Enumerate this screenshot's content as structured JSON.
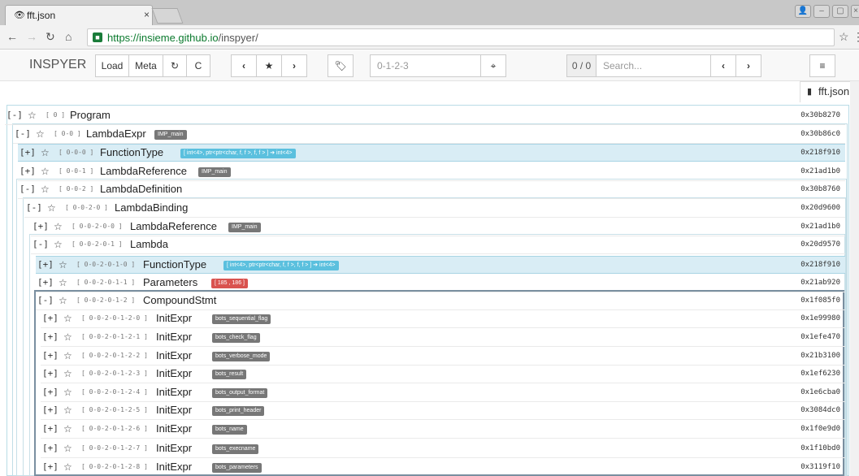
{
  "browser": {
    "tab_title": "fft.json",
    "tab_icon": "eye-icon",
    "url_host": "https://insieme.github.io",
    "url_path": "/inspyer/"
  },
  "toolbar": {
    "brand": "INSPYER",
    "load": "Load",
    "meta": "Meta",
    "path_placeholder": "0-1-2-3",
    "count": "0 / 0",
    "search_placeholder": "Search..."
  },
  "file_tab": "fft.json",
  "tree": {
    "rows": [
      {
        "t": "[-]",
        "a": "[ 0 ]",
        "n": "Program",
        "b": "",
        "bt": "",
        "p": "0x30b8270"
      },
      {
        "t": "[-]",
        "a": "[ 0-0 ]",
        "n": "LambdaExpr",
        "b": "IMP_main",
        "bt": "gray",
        "p": "0x30b86c0"
      },
      {
        "t": "[+]",
        "a": "[ 0-0-0 ]",
        "n": "FunctionType",
        "b": "[ int<4>, ptr<ptr<char, f, f >, f, f > ] ➔ int<4>",
        "bt": "blue",
        "p": "0x218f910"
      },
      {
        "t": "[+]",
        "a": "[ 0-0-1 ]",
        "n": "LambdaReference",
        "b": "IMP_main",
        "bt": "gray",
        "p": "0x21ad1b0"
      },
      {
        "t": "[-]",
        "a": "[ 0-0-2 ]",
        "n": "LambdaDefinition",
        "b": "",
        "bt": "",
        "p": "0x30b8760"
      },
      {
        "t": "[-]",
        "a": "[ 0-0-2-0 ]",
        "n": "LambdaBinding",
        "b": "",
        "bt": "",
        "p": "0x20d9600"
      },
      {
        "t": "[+]",
        "a": "[ 0-0-2-0-0 ]",
        "n": "LambdaReference",
        "b": "IMP_main",
        "bt": "gray",
        "p": "0x21ad1b0"
      },
      {
        "t": "[-]",
        "a": "[ 0-0-2-0-1 ]",
        "n": "Lambda",
        "b": "",
        "bt": "",
        "p": "0x20d9570"
      },
      {
        "t": "[+]",
        "a": "[ 0-0-2-0-1-0 ]",
        "n": "FunctionType",
        "b": "[ int<4>, ptr<ptr<char, f, f >, f, f > ] ➔ int<4>",
        "bt": "blue",
        "p": "0x218f910"
      },
      {
        "t": "[+]",
        "a": "[ 0-0-2-0-1-1 ]",
        "n": "Parameters",
        "b": "[ 185 , 186 ]",
        "bt": "red",
        "p": "0x21ab920"
      },
      {
        "t": "[-]",
        "a": "[ 0-0-2-0-1-2 ]",
        "n": "CompoundStmt",
        "b": "",
        "bt": "",
        "p": "0x1f085f0"
      },
      {
        "t": "[+]",
        "a": "[ 0-0-2-0-1-2-0 ]",
        "n": "InitExpr",
        "b": "bots_sequential_flag",
        "bt": "gray",
        "p": "0x1e99980"
      },
      {
        "t": "[+]",
        "a": "[ 0-0-2-0-1-2-1 ]",
        "n": "InitExpr",
        "b": "bots_check_flag",
        "bt": "gray",
        "p": "0x1efe470"
      },
      {
        "t": "[+]",
        "a": "[ 0-0-2-0-1-2-2 ]",
        "n": "InitExpr",
        "b": "bots_verbose_mode",
        "bt": "gray",
        "p": "0x21b3100"
      },
      {
        "t": "[+]",
        "a": "[ 0-0-2-0-1-2-3 ]",
        "n": "InitExpr",
        "b": "bots_result",
        "bt": "gray",
        "p": "0x1ef6230"
      },
      {
        "t": "[+]",
        "a": "[ 0-0-2-0-1-2-4 ]",
        "n": "InitExpr",
        "b": "bots_output_format",
        "bt": "gray",
        "p": "0x1e6cba0"
      },
      {
        "t": "[+]",
        "a": "[ 0-0-2-0-1-2-5 ]",
        "n": "InitExpr",
        "b": "bots_print_header",
        "bt": "gray",
        "p": "0x3084dc0"
      },
      {
        "t": "[+]",
        "a": "[ 0-0-2-0-1-2-6 ]",
        "n": "InitExpr",
        "b": "bots_name",
        "bt": "gray",
        "p": "0x1f0e9d0"
      },
      {
        "t": "[+]",
        "a": "[ 0-0-2-0-1-2-7 ]",
        "n": "InitExpr",
        "b": "bots_execname",
        "bt": "gray",
        "p": "0x1f10bd0"
      },
      {
        "t": "[+]",
        "a": "[ 0-0-2-0-1-2-8 ]",
        "n": "InitExpr",
        "b": "bots_parameters",
        "bt": "gray",
        "p": "0x3119f10"
      }
    ]
  }
}
